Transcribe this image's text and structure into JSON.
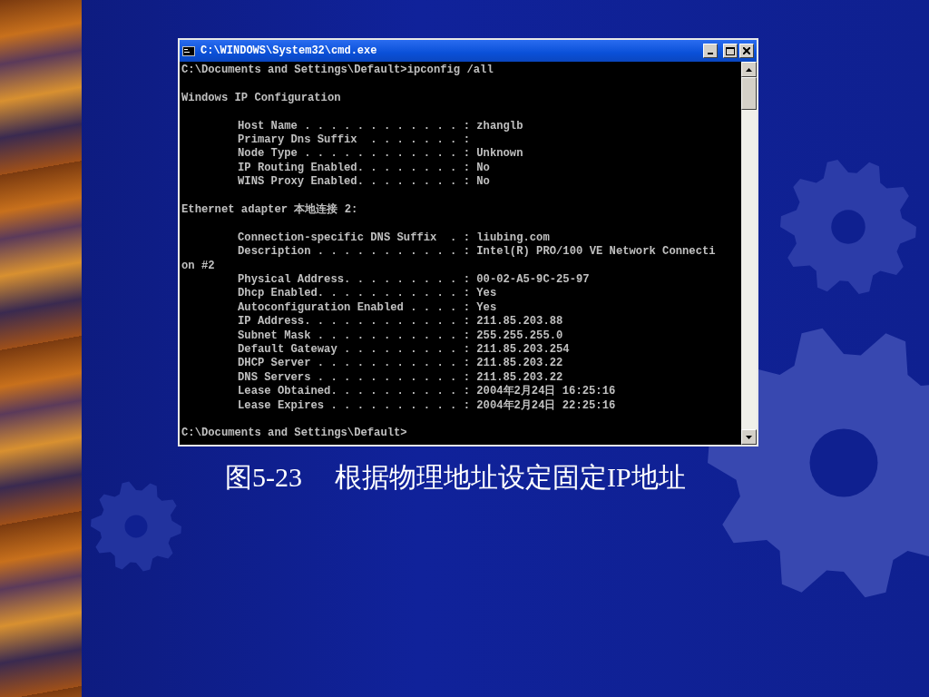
{
  "window": {
    "title": "C:\\WINDOWS\\System32\\cmd.exe"
  },
  "console": {
    "blocks": [
      [
        {
          "kind": "plain",
          "text": "C:\\Documents and Settings\\Default>ipconfig /all"
        }
      ],
      [
        {
          "kind": "plain",
          "text": "Windows IP Configuration"
        }
      ],
      [
        {
          "kind": "indented",
          "text": "Host Name . . . . . . . . . . . . : zhanglb"
        },
        {
          "kind": "indented",
          "text": "Primary Dns Suffix  . . . . . . . :"
        },
        {
          "kind": "indented",
          "text": "Node Type . . . . . . . . . . . . : Unknown"
        },
        {
          "kind": "indented",
          "text": "IP Routing Enabled. . . . . . . . : No"
        },
        {
          "kind": "indented",
          "text": "WINS Proxy Enabled. . . . . . . . : No"
        }
      ],
      [
        {
          "kind": "plain",
          "text": "Ethernet adapter 本地连接 2:"
        }
      ],
      [
        {
          "kind": "indented",
          "text": "Connection-specific DNS Suffix  . : liubing.com"
        },
        {
          "kind": "indented",
          "text": "Description . . . . . . . . . . . : Intel(R) PRO/100 VE Network Connecti"
        },
        {
          "kind": "plain",
          "text": "on #2"
        },
        {
          "kind": "indented",
          "text": "Physical Address. . . . . . . . . : 00-02-A5-9C-25-97"
        },
        {
          "kind": "indented",
          "text": "Dhcp Enabled. . . . . . . . . . . : Yes"
        },
        {
          "kind": "indented",
          "text": "Autoconfiguration Enabled . . . . : Yes"
        },
        {
          "kind": "indented",
          "text": "IP Address. . . . . . . . . . . . : 211.85.203.88"
        },
        {
          "kind": "indented",
          "text": "Subnet Mask . . . . . . . . . . . : 255.255.255.0"
        },
        {
          "kind": "indented",
          "text": "Default Gateway . . . . . . . . . : 211.85.203.254"
        },
        {
          "kind": "indented",
          "text": "DHCP Server . . . . . . . . . . . : 211.85.203.22"
        },
        {
          "kind": "indented",
          "text": "DNS Servers . . . . . . . . . . . : 211.85.203.22"
        },
        {
          "kind": "indented",
          "text": "Lease Obtained. . . . . . . . . . : 2004年2月24日 16:25:16"
        },
        {
          "kind": "indented",
          "text": "Lease Expires . . . . . . . . . . : 2004年2月24日 22:25:16"
        }
      ],
      [
        {
          "kind": "plain",
          "text": "C:\\Documents and Settings\\Default>"
        }
      ]
    ]
  },
  "caption": {
    "figure": "图5-23",
    "text": "根据物理地址设定固定IP地址"
  }
}
